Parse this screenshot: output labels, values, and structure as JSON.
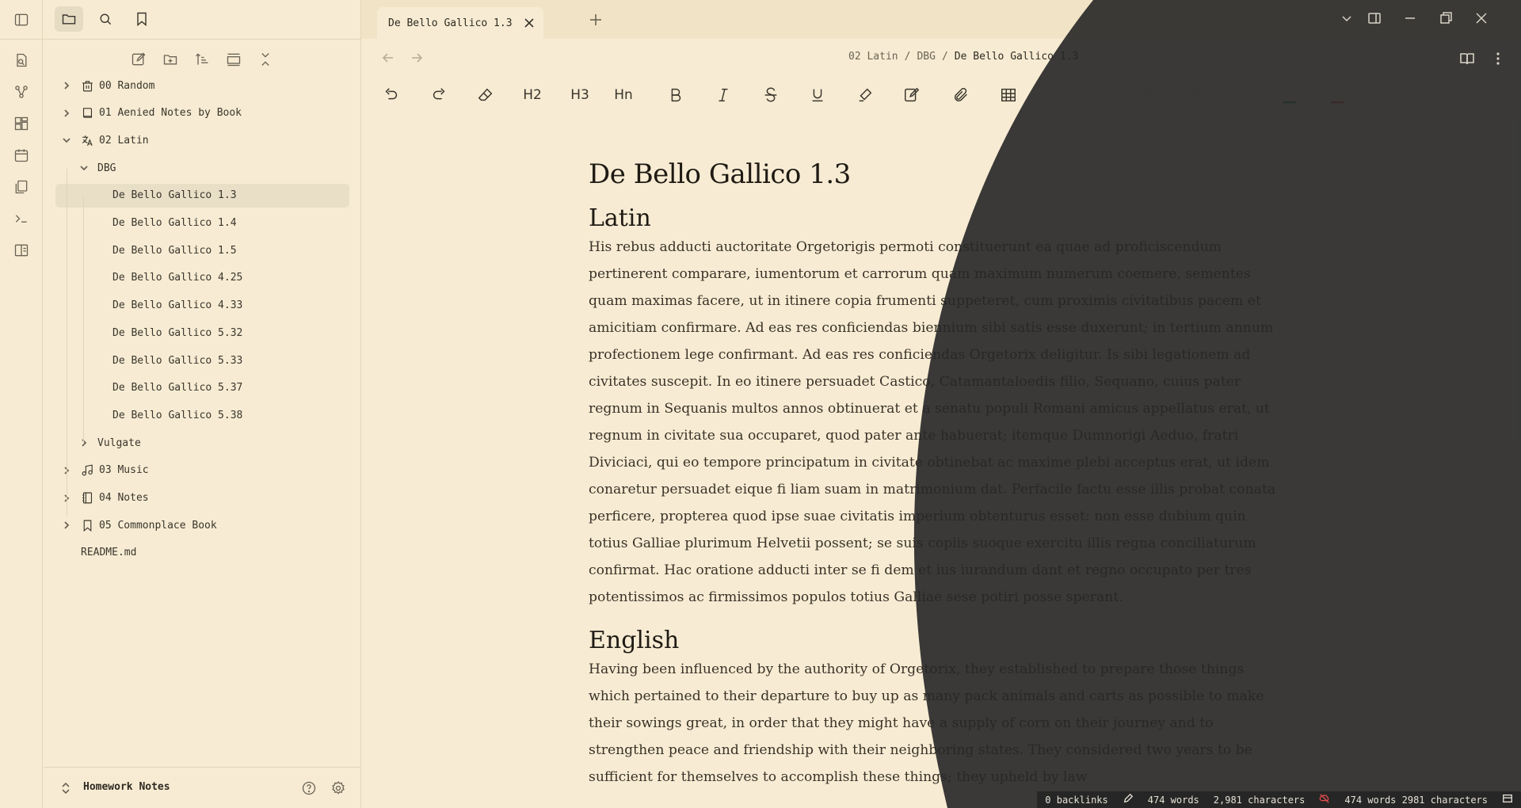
{
  "sidebar_tabs": [
    "files-icon",
    "search-icon",
    "bookmark-icon"
  ],
  "tree": [
    {
      "label": "00 Random",
      "icon": "trash-icon",
      "level": 0,
      "expanded": false
    },
    {
      "label": "01 Aenied Notes by Book",
      "icon": "book-icon",
      "level": 0,
      "expanded": false
    },
    {
      "label": "02 Latin",
      "icon": "translate-icon",
      "level": 0,
      "expanded": true
    },
    {
      "label": "DBG",
      "icon": "",
      "level": 1,
      "expanded": true
    },
    {
      "label": "De Bello Gallico 1.3",
      "level": 2,
      "selected": true
    },
    {
      "label": "De Bello Gallico 1.4",
      "level": 2
    },
    {
      "label": "De Bello Gallico 1.5",
      "level": 2
    },
    {
      "label": "De Bello Gallico 4.25",
      "level": 2
    },
    {
      "label": "De Bello Gallico 4.33",
      "level": 2
    },
    {
      "label": "De Bello Gallico 5.32",
      "level": 2
    },
    {
      "label": "De Bello Gallico 5.33",
      "level": 2
    },
    {
      "label": "De Bello Gallico 5.37",
      "level": 2
    },
    {
      "label": "De Bello Gallico 5.38",
      "level": 2
    },
    {
      "label": "Vulgate",
      "icon": "",
      "level": 1,
      "expanded": false
    },
    {
      "label": "03 Music",
      "icon": "music-icon",
      "level": 0,
      "expanded": false
    },
    {
      "label": "04 Notes",
      "icon": "notebook-icon",
      "level": 0,
      "expanded": false
    },
    {
      "label": "05 Commonplace Book",
      "icon": "bookmark-icon",
      "level": 0,
      "expanded": false
    },
    {
      "label": "README.md",
      "level": 0,
      "file": true
    }
  ],
  "vault_name": "Homework Notes",
  "tab_title": "De Bello Gallico 1.3",
  "breadcrumb": [
    "02 Latin",
    "DBG",
    "De Bello Gallico 1.3"
  ],
  "breadcrumb_sep": "/",
  "toolbar": {
    "h2": "H2",
    "h3": "H3",
    "hn": "Hn"
  },
  "doc": {
    "title": "De Bello Gallico 1.3",
    "latin_heading": "Latin",
    "latin_text": "His rebus adducti auctoritate Orgetorigis permoti constituerunt ea quae ad proficiscendum pertinerent comparare, iumentorum et carrorum quam maximum numerum coemere, sementes quam maximas facere, ut in itinere copia frumenti suppeteret, cum proximis civitatibus pacem et amicitiam confirmare. Ad eas res conficiendas biennium sibi satis esse duxerunt; in tertium annum profectionem lege confirmant. Ad eas res conficiendas Orgetorix deligitur. Is sibi legationem ad civitates suscepit. In eo itinere persuadet Castico, Catamantaloedis filio, Sequano, cuius pater regnum in Sequanis multos annos obtinuerat et a senatu populi Romani amicus appellatus erat, ut regnum in civitate sua occuparet, quod pater ante habuerat; itemque Dumnorigi Aeduo, fratri Diviciaci, qui eo tempore principatum in civitate obtinebat ac maxime plebi acceptus erat, ut idem conaretur persuadet eique fi liam suam in matrimonium dat. Perfacile factu esse illis probat conata perficere, propterea quod ipse suae civitatis imperium obtenturus esset: non esse dubium quin totius Galliae plurimum Helvetii possent; se suis copiis suoque exercitu illis regna conciliaturum confirmat. Hac oratione adducti inter se fi dem et ius iurandum dant et regno occupato per tres potentissimos ac firmissimos populos totius Galliae sese potiri posse sperant.",
    "english_heading": "English",
    "english_text": "Having been influenced by the authority of Orgetorix, they established to prepare those things which pertained to their departure to buy up as many pack animals and carts as possible to make their sowings great, in order that they might have a supply of corn on their journey and to strengthen peace and friendship with their neighboring states. They considered two years to be sufficient for themselves to accomplish these things; they upheld by law"
  },
  "status": {
    "backlinks": "0 backlinks",
    "words1": "474 words",
    "chars1": "2,981 characters",
    "words_chars2": "474 words 2981 characters"
  },
  "colors": {
    "bg": "#f7ecd3",
    "dark": "#262626",
    "accent_green": "#2e9b4a",
    "accent_red": "#e24a4a"
  }
}
